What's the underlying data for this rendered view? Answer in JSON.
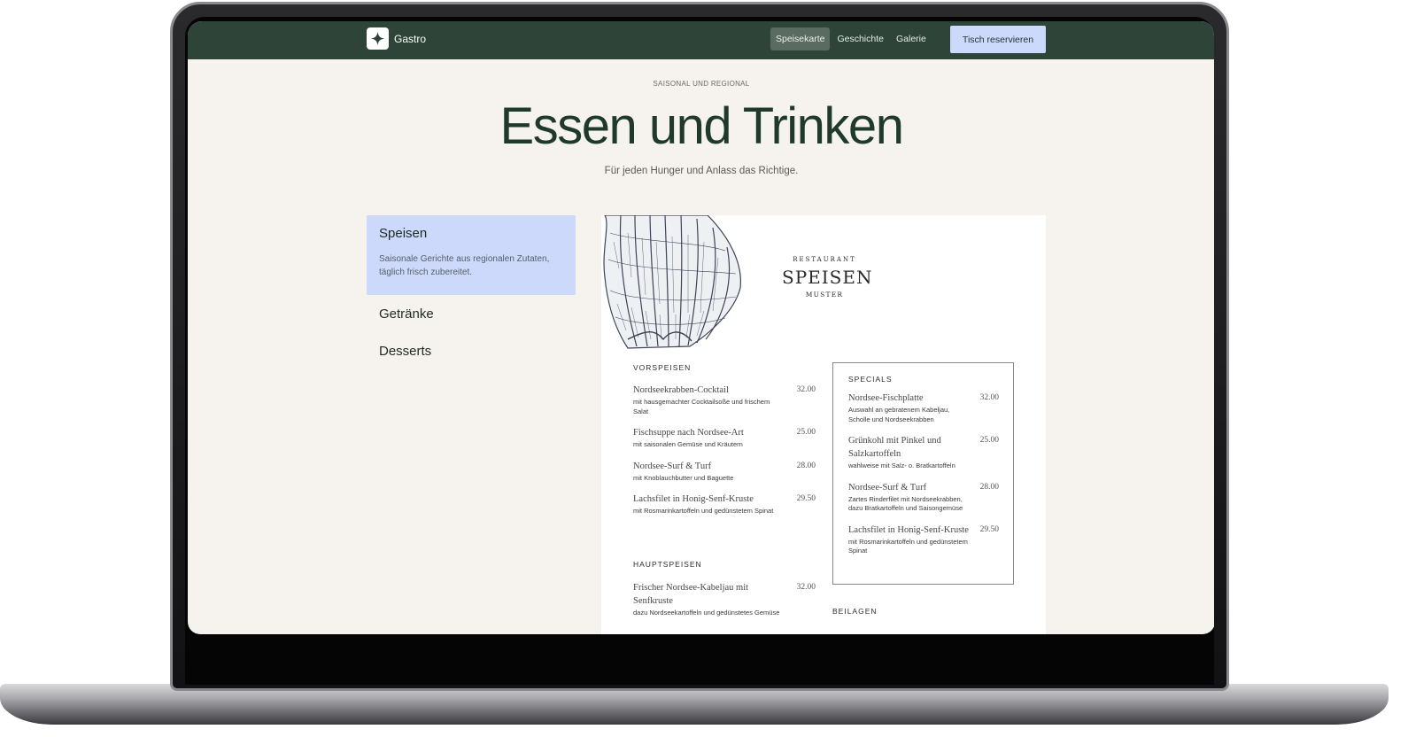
{
  "nav": {
    "brand": "Gastro",
    "links": [
      "Speisekarte",
      "Geschichte",
      "Galerie"
    ],
    "active_link": "Speisekarte",
    "cta": "Tisch reservieren"
  },
  "hero": {
    "eyebrow": "SAISONAL UND REGIONAL",
    "title": "Essen und Trinken",
    "subtitle": "Für jeden Hunger und Anlass das Richtige."
  },
  "categories": [
    {
      "title": "Speisen",
      "description": "Saisonale Gerichte aus regionalen Zutaten, täglich frisch zubereitet.",
      "active": true
    },
    {
      "title": "Getränke"
    },
    {
      "title": "Desserts"
    }
  ],
  "menu_card": {
    "badge_arc": "RESTAURANT",
    "badge_title": "SPEISEN",
    "badge_sub": "MUSTER",
    "vorspeisen": {
      "heading": "VORSPEISEN",
      "items": [
        {
          "name": "Nordseekrabben-Cocktail",
          "desc": "mit hausgemachter Cocktailsoße und frischem Salat",
          "price": "32.00"
        },
        {
          "name": "Fischsuppe nach Nordsee-Art",
          "desc": "mit saisonalen Gemüse und Kräutern",
          "price": "25.00"
        },
        {
          "name": "Nordsee-Surf & Turf",
          "desc": "mit Knoblauchbutter und Baguette",
          "price": "28.00"
        },
        {
          "name": "Lachsfilet in Honig-Senf-Kruste",
          "desc": "mit Rosmarinkartoffeln und gedünstetem Spinat",
          "price": "29.50"
        }
      ]
    },
    "hauptspeisen": {
      "heading": "HAUPTSPEISEN",
      "items": [
        {
          "name": "Frischer Nordsee-Kabeljau mit Senfkruste",
          "desc": "dazu Nordseekartoffeln und gedünstetes Gemüse",
          "price": "32.00"
        }
      ]
    },
    "specials": {
      "heading": "SPECIALS",
      "items": [
        {
          "name": "Nordsee-Fischplatte",
          "desc": "Auswahl an gebratenem Kabeljau, Scholle und Nordseekrabben",
          "price": "32.00"
        },
        {
          "name": "Grünkohl mit Pinkel und Salzkartoffeln",
          "desc": "wahlweise mit Salz- o. Bratkartoffeln",
          "price": "25.00"
        },
        {
          "name": "Nordsee-Surf & Turf",
          "desc": "Zartes Rinderfilet mit Nordseekrabben, dazu Bratkartoffeln und Saisongemüse",
          "price": "28.00"
        },
        {
          "name": "Lachsfilet in Honig-Senf-Kruste",
          "desc": "mit Rosmarinkartoffeln und gedünstetem Spinat",
          "price": "29.50"
        }
      ]
    },
    "beilagen": {
      "heading": "BEILAGEN"
    }
  },
  "colors": {
    "nav_bg": "#2e4438",
    "accent": "#cdd9fb",
    "title": "#1f3a2b",
    "page_bg": "#f6f2ee"
  }
}
